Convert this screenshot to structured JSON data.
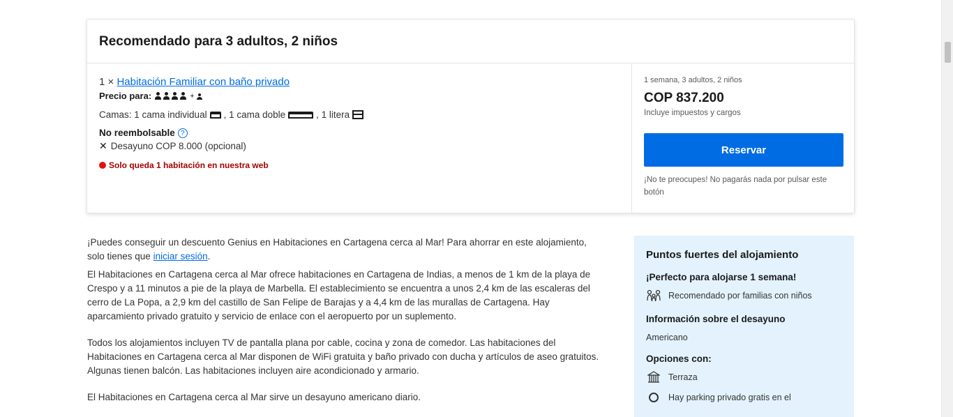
{
  "recommendation": {
    "title": "Recomendado para 3 adultos, 2 niños",
    "room_count": "1 ×",
    "room_name": "Habitación Familiar con baño privado",
    "price_for_label": "Precio para:",
    "adults": 4,
    "children": 1,
    "beds": {
      "prefix": "Camas: 1 cama individual",
      "double": ", 1 cama doble",
      "bunk": ", 1 litera"
    },
    "non_refundable": "No reembolsable",
    "info_symbol": "?",
    "breakfast": "Desayuno COP 8.000 (opcional)",
    "urgency": "Solo queda 1 habitación en nuestra web"
  },
  "booking": {
    "summary": "1 semana, 3 adultos, 2 niños",
    "price": "COP 837.200",
    "taxes": "Incluye impuestos y cargos",
    "reserve_label": "Reservar",
    "reassure": "¡No te preocupes! No pagarás nada por pulsar este botón"
  },
  "description": {
    "genius_before": "¡Puedes conseguir un descuento Genius en Habitaciones en Cartagena cerca al Mar! Para ahorrar en este alojamiento, solo tienes que ",
    "genius_link": "iniciar sesión",
    "genius_after": ".",
    "para1": "El Habitaciones en Cartagena cerca al Mar ofrece habitaciones en Cartagena de Indias, a menos de 1 km de la playa de Crespo y a 11 minutos a pie de la playa de Marbella. El establecimiento se encuentra a unos 2,4 km de las escaleras del cerro de La Popa, a 2,9 km del castillo de San Felipe de Barajas y a 4,4 km de las murallas de Cartagena. Hay aparcamiento privado gratuito y servicio de enlace con el aeropuerto por un suplemento.",
    "para2": "Todos los alojamientos incluyen TV de pantalla plana por cable, cocina y zona de comedor. Las habitaciones del Habitaciones en Cartagena cerca al Mar disponen de WiFi gratuita y baño privado con ducha y artículos de aseo gratuitos. Algunas tienen balcón. Las habitaciones incluyen aire acondicionado y armario.",
    "para3": "El Habitaciones en Cartagena cerca al Mar sirve un desayuno americano diario."
  },
  "highlights": {
    "title": "Puntos fuertes del alojamiento",
    "stay_heading": "¡Perfecto para alojarse 1 semana!",
    "family_text": "Recomendado por familias con niños",
    "breakfast_heading": "Información sobre el desayuno",
    "breakfast_value": "Americano",
    "options_heading": "Opciones con:",
    "terrace": "Terraza",
    "parking": "Hay parking privado gratis en el"
  }
}
